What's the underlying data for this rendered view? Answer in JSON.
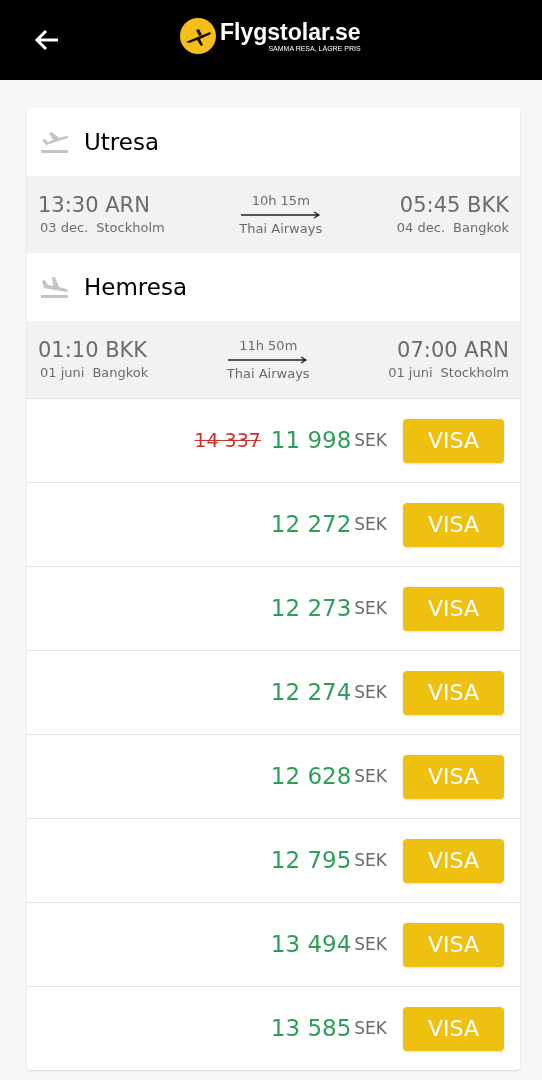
{
  "header": {
    "brand": "Flygstolar.se",
    "tagline": "SAMMA RESA, LÄGRE PRIS"
  },
  "legs": [
    {
      "kind": "outbound",
      "title": "Utresa",
      "depart_time": "13:30 ARN",
      "depart_date": "03 dec.",
      "depart_city": "Stockholm",
      "duration": "10h 15m",
      "airline": "Thai Airways",
      "arrive_time": "05:45 BKK",
      "arrive_date": "04 dec.",
      "arrive_city": "Bangkok"
    },
    {
      "kind": "return",
      "title": "Hemresa",
      "depart_time": "01:10 BKK",
      "depart_date": "01 juni",
      "depart_city": "Bangkok",
      "duration": "11h 50m",
      "airline": "Thai Airways",
      "arrive_time": "07:00 ARN",
      "arrive_date": "01 juni",
      "arrive_city": "Stockholm"
    }
  ],
  "offers": [
    {
      "old_price": "14 337",
      "price": "11 998",
      "currency": "SEK",
      "button": "VISA"
    },
    {
      "price": "12 272",
      "currency": "SEK",
      "button": "VISA"
    },
    {
      "price": "12 273",
      "currency": "SEK",
      "button": "VISA"
    },
    {
      "price": "12 274",
      "currency": "SEK",
      "button": "VISA"
    },
    {
      "price": "12 628",
      "currency": "SEK",
      "button": "VISA"
    },
    {
      "price": "12 795",
      "currency": "SEK",
      "button": "VISA"
    },
    {
      "price": "13 494",
      "currency": "SEK",
      "button": "VISA"
    },
    {
      "price": "13 585",
      "currency": "SEK",
      "button": "VISA"
    }
  ]
}
